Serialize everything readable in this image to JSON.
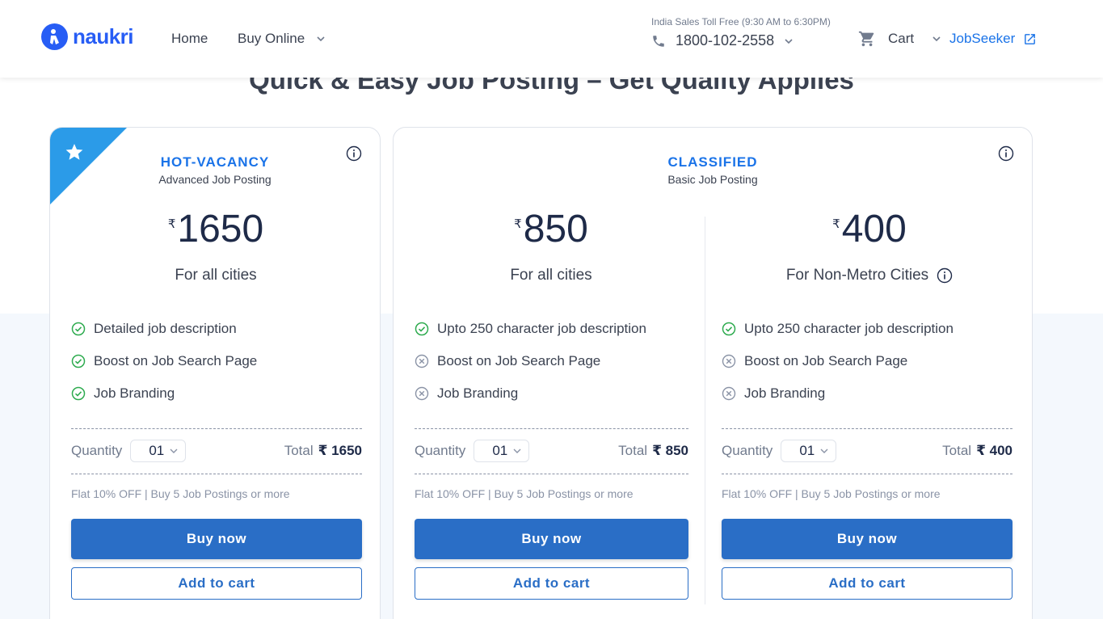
{
  "header": {
    "logo_text": "naukri",
    "nav_home": "Home",
    "nav_buy_online": "Buy Online",
    "toll_free_label": "India Sales Toll Free (9:30 AM to 6:30PM)",
    "phone_number": "1800-102-2558",
    "cart_label": "Cart",
    "jobseeker_label": "JobSeeker",
    "brand_color": "#275df5",
    "link_color": "#1a73e8"
  },
  "page_title": "Quick & Easy Job Posting – Get Quality Applies",
  "plans": [
    {
      "name": "HOT-VACANCY",
      "subtitle": "Advanced Job Posting",
      "currency": "₹",
      "price": "1650",
      "city_label": "For all cities",
      "features": [
        {
          "text": "Detailed job description",
          "included": true
        },
        {
          "text": "Boost on Job Search Page",
          "included": true
        },
        {
          "text": "Job Branding",
          "included": true
        }
      ],
      "quantity_label": "Quantity",
      "quantity_value": "01",
      "total_label": "Total",
      "total_value": "₹ 1650",
      "offer_text": "Flat 10% OFF | Buy 5 Job Postings or more",
      "buy_label": "Buy now",
      "cart_label": "Add to cart"
    },
    {
      "name": "CLASSIFIED",
      "subtitle": "Basic Job Posting",
      "currency": "₹",
      "price": "850",
      "city_label": "For all cities",
      "features": [
        {
          "text": "Upto 250 character job description",
          "included": true
        },
        {
          "text": "Boost on Job Search Page",
          "included": false
        },
        {
          "text": "Job Branding",
          "included": false
        }
      ],
      "quantity_label": "Quantity",
      "quantity_value": "01",
      "total_label": "Total",
      "total_value": "₹ 850",
      "offer_text": "Flat 10% OFF | Buy 5 Job Postings or more",
      "buy_label": "Buy now",
      "cart_label": "Add to cart"
    },
    {
      "currency": "₹",
      "price": "400",
      "city_label": "For Non-Metro Cities",
      "features": [
        {
          "text": "Upto 250 character job description",
          "included": true
        },
        {
          "text": "Boost on Job Search Page",
          "included": false
        },
        {
          "text": "Job Branding",
          "included": false
        }
      ],
      "quantity_label": "Quantity",
      "quantity_value": "01",
      "total_label": "Total",
      "total_value": "₹ 400",
      "offer_text": "Flat 10% OFF | Buy 5 Job Postings or more",
      "buy_label": "Buy now",
      "cart_label": "Add to cart"
    }
  ],
  "colors": {
    "primary_button": "#2a6ec6",
    "ribbon": "#2b9be8",
    "check_green": "#2eab4f",
    "cross_gray": "#8a93a6"
  }
}
